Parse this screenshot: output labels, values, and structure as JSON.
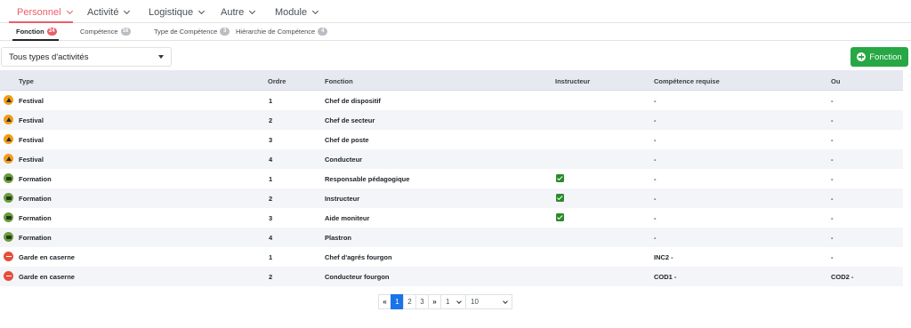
{
  "topnav": {
    "items": [
      {
        "label": "Personnel",
        "active": true
      },
      {
        "label": "Activité",
        "active": false
      },
      {
        "label": "Logistique",
        "active": false
      },
      {
        "label": "Autre",
        "active": false
      },
      {
        "label": "Module",
        "active": false
      }
    ]
  },
  "subtabs": [
    {
      "label": "Fonction",
      "count": "24",
      "active": true
    },
    {
      "label": "Compétence",
      "count": "16",
      "active": false
    },
    {
      "label": "Type de Compétence",
      "count": "3",
      "active": false
    },
    {
      "label": "Hiérarchie de Compétence",
      "count": "4",
      "active": false
    }
  ],
  "filter": {
    "value": "Tous types d'activités"
  },
  "add_button": {
    "label": "Fonction"
  },
  "table": {
    "headers": {
      "type": "Type",
      "ordre": "Ordre",
      "fonction": "Fonction",
      "instructeur": "Instructeur",
      "competence": "Compétence requise",
      "ou": "Ou"
    },
    "rows": [
      {
        "icon": "festival-icon",
        "type": "Festival",
        "ordre": "1",
        "fonction": "Chef de dispositif",
        "instructeur": false,
        "competence": "-",
        "ou": "-"
      },
      {
        "icon": "festival-icon",
        "type": "Festival",
        "ordre": "2",
        "fonction": "Chef de secteur",
        "instructeur": false,
        "competence": "-",
        "ou": "-"
      },
      {
        "icon": "festival-icon",
        "type": "Festival",
        "ordre": "3",
        "fonction": "Chef de poste",
        "instructeur": false,
        "competence": "-",
        "ou": "-"
      },
      {
        "icon": "festival-icon",
        "type": "Festival",
        "ordre": "4",
        "fonction": "Conducteur",
        "instructeur": false,
        "competence": "-",
        "ou": "-"
      },
      {
        "icon": "formation-icon",
        "type": "Formation",
        "ordre": "1",
        "fonction": "Responsable pédagogique",
        "instructeur": true,
        "competence": "-",
        "ou": "-"
      },
      {
        "icon": "formation-icon",
        "type": "Formation",
        "ordre": "2",
        "fonction": "Instructeur",
        "instructeur": true,
        "competence": "-",
        "ou": "-"
      },
      {
        "icon": "formation-icon",
        "type": "Formation",
        "ordre": "3",
        "fonction": "Aide moniteur",
        "instructeur": true,
        "competence": "-",
        "ou": "-"
      },
      {
        "icon": "formation-icon",
        "type": "Formation",
        "ordre": "4",
        "fonction": "Plastron",
        "instructeur": false,
        "competence": "-",
        "ou": "-"
      },
      {
        "icon": "garde-icon",
        "type": "Garde en caserne",
        "ordre": "1",
        "fonction": "Chef d'agrés fourgon",
        "instructeur": false,
        "competence": "INC2 -",
        "ou": "-"
      },
      {
        "icon": "garde-icon",
        "type": "Garde en caserne",
        "ordre": "2",
        "fonction": "Conducteur fourgon",
        "instructeur": false,
        "competence": "COD1 -",
        "ou": "COD2 -"
      }
    ]
  },
  "pagination": {
    "first": "«",
    "pages": [
      "1",
      "2",
      "3"
    ],
    "current_page": "1",
    "last": "»",
    "page_select": "1",
    "page_size": "10"
  },
  "colors": {
    "accent": "#e8606a",
    "primary": "#1a73e8",
    "success": "#28a745"
  }
}
